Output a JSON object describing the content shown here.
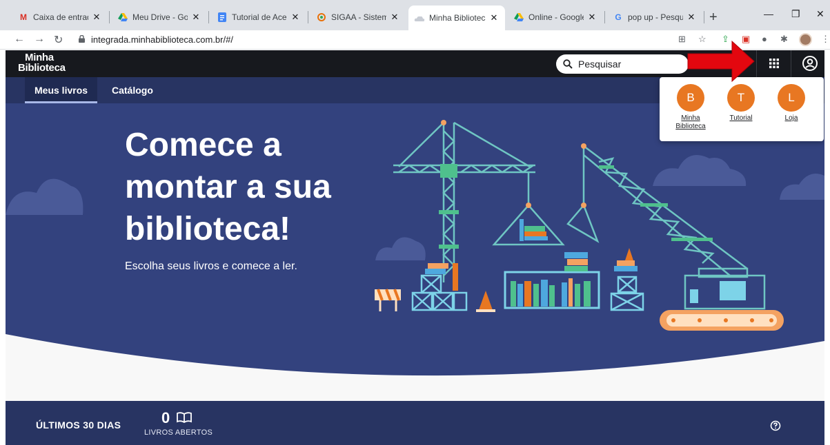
{
  "browser": {
    "tabs": [
      {
        "title": "Caixa de entrada (",
        "icon": "gmail-icon"
      },
      {
        "title": "Meu Drive - Googl",
        "icon": "drive-icon"
      },
      {
        "title": "Tutorial de Acesso",
        "icon": "docs-icon"
      },
      {
        "title": "SIGAA - Sistema In",
        "icon": "sigaa-icon"
      },
      {
        "title": "Minha Biblioteca",
        "icon": "cloud-icon",
        "active": true
      },
      {
        "title": "Online - Google D",
        "icon": "drive-icon"
      },
      {
        "title": "pop up - Pesquisa",
        "icon": "google-icon"
      }
    ],
    "new_tab": "+",
    "url": "integrada.minhabiblioteca.com.br/#/"
  },
  "header": {
    "logo_line1": "Minha",
    "logo_line2": "Biblioteca",
    "search_placeholder": "Pesquisar"
  },
  "subnav": {
    "tabs": [
      {
        "label": "Meus livros",
        "active": true
      },
      {
        "label": "Catálogo",
        "active": false
      }
    ]
  },
  "hero": {
    "title_line1": "Comece a",
    "title_line2": "montar a sua",
    "title_line3": "biblioteca!",
    "subtitle": "Escolha seus livros e comece a ler."
  },
  "stats": {
    "period": "ÚLTIMOS 30 DIAS",
    "count": "0",
    "count_label": "LIVROS ABERTOS"
  },
  "apps_menu": {
    "items": [
      {
        "initial": "B",
        "label_line1": "Minha",
        "label_line2": "Biblioteca"
      },
      {
        "initial": "T",
        "label_line1": "Tutorial",
        "label_line2": ""
      },
      {
        "initial": "L",
        "label_line1": "Loja",
        "label_line2": ""
      }
    ]
  },
  "colors": {
    "header": "#17191e",
    "subnav": "#283462",
    "hero": "#33427e",
    "accent_orange": "#e87722",
    "arrow_red": "#e3070f"
  }
}
